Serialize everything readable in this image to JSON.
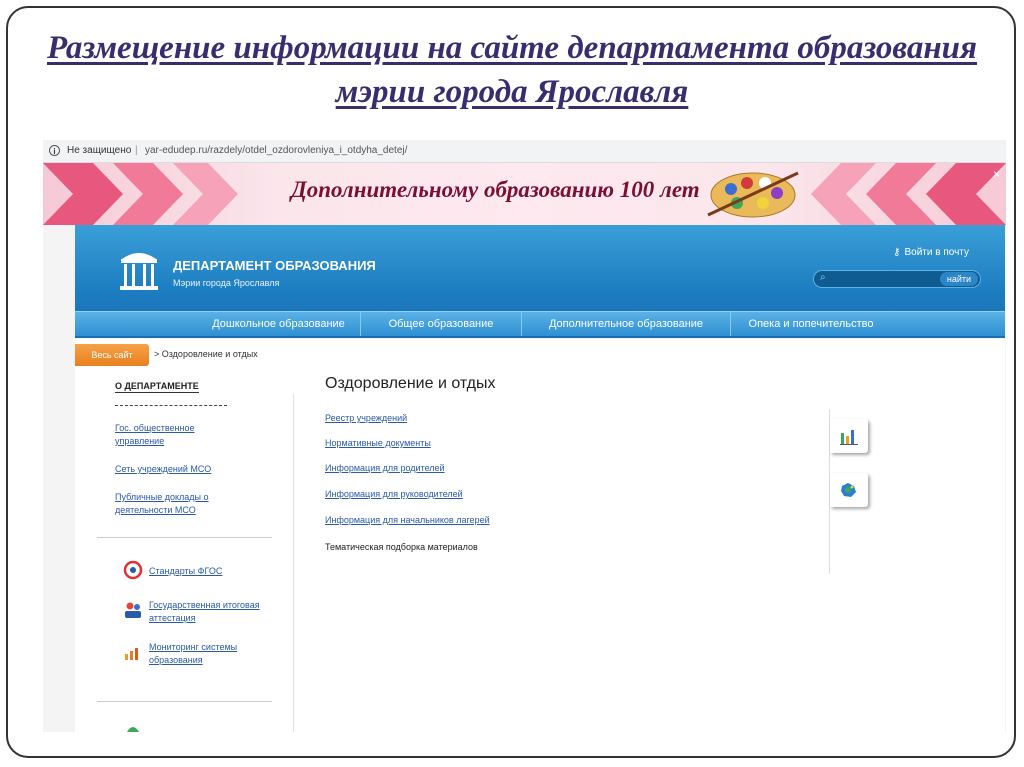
{
  "slide": {
    "title": "Размещение информации на сайте департамента образования мэрии города Ярославля"
  },
  "browser": {
    "security": "Не защищено",
    "url": "yar-edudep.ru/razdely/otdel_ozdorovleniya_i_otdyha_detej/"
  },
  "banner": {
    "text": "Дополнительному образованию 100 лет",
    "close": "×"
  },
  "header": {
    "dept_name": "ДЕПАРТАМЕНТ ОБРАЗОВАНИЯ",
    "dept_sub": "Мэрии города Ярославля",
    "login": "Войти в почту",
    "search_button": "найти",
    "search_value": ""
  },
  "nav": [
    {
      "label": "Дошкольное образование"
    },
    {
      "label": "Общее образование"
    },
    {
      "label": "Дополнительное образование"
    },
    {
      "label": "Опека и попечительство"
    }
  ],
  "breadcrumb": {
    "home": "Весь сайт",
    "current": "> Оздоровление и отдых"
  },
  "sidebar": {
    "heading": "О ДЕПАРТАМЕНТЕ",
    "links": [
      {
        "label": "Гос. общественное управление"
      },
      {
        "label": "Сеть учреждений МСО"
      },
      {
        "label": "Публичные доклады о деятельности МСО"
      }
    ],
    "icon_links": [
      {
        "label": "Стандарты ФГОС"
      },
      {
        "label": "Государственная итоговая аттестация"
      },
      {
        "label": "Мониторинг системы образования"
      }
    ]
  },
  "main": {
    "title": "Оздоровление и отдых",
    "links": [
      {
        "label": "Реестр учреждений"
      },
      {
        "label": "Нормативные документы"
      },
      {
        "label": "Информация для родителей"
      },
      {
        "label": "Информация для руководителей"
      },
      {
        "label": "Информация для начальников лагерей"
      }
    ],
    "static_item": "Тематическая подборка материалов"
  },
  "colors": {
    "accent_blue": "#1c7cc0",
    "orange": "#e8801e",
    "link": "#2a5aa8",
    "title": "#3a2d6e"
  }
}
